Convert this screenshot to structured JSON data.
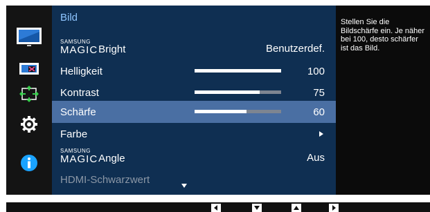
{
  "menu": {
    "title": "Bild",
    "rows": [
      {
        "label_prefix_top": "SAMSUNG",
        "label_prefix_bottom": "MAGIC",
        "label": "Bright",
        "value": "Benutzerdef."
      },
      {
        "label": "Helligkeit",
        "value": "100",
        "slider_fraction": 1.0
      },
      {
        "label": "Kontrast",
        "value": "75",
        "slider_fraction": 0.75
      },
      {
        "label": "Schärfe",
        "value": "60",
        "slider_fraction": 0.6,
        "selected": true
      },
      {
        "label": "Farbe",
        "value": ""
      },
      {
        "label_prefix_top": "SAMSUNG",
        "label_prefix_bottom": "MAGIC",
        "label": "Angle",
        "value": "Aus"
      },
      {
        "label": "HDMI-Schwarzwert",
        "value": "",
        "disabled": true
      }
    ]
  },
  "help": {
    "text": "Stellen Sie die Bildschärfe ein. Je näher bei 100, desto schärfer ist das Bild."
  },
  "sidebar": {
    "icons": [
      "picture-icon",
      "color-icon",
      "size-position-icon",
      "settings-icon",
      "information-icon"
    ]
  },
  "nav_keys": [
    "left-arrow-key-icon",
    "down-arrow-key-icon",
    "up-arrow-key-icon",
    "right-arrow-key-icon"
  ],
  "colors": {
    "menu_background": "#0f2f52",
    "selected_row": "#4a6fa3",
    "title_accent": "#8ec5ff",
    "info_icon": "#1aa3ff"
  }
}
